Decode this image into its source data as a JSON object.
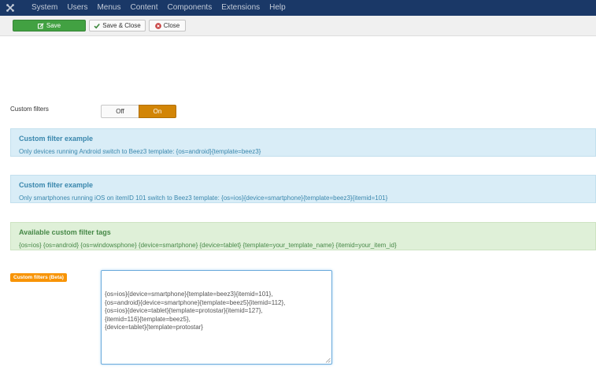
{
  "nav": {
    "logo_icon": "joomla-icon",
    "items": [
      "System",
      "Users",
      "Menus",
      "Content",
      "Components",
      "Extensions",
      "Help"
    ]
  },
  "toolbar": {
    "save_label": "Save",
    "save_close_label": "Save & Close",
    "close_label": "Close"
  },
  "custom_filters": {
    "label": "Custom filters",
    "off_label": "Off",
    "on_label": "On",
    "selected": "On"
  },
  "alerts": [
    {
      "title": "Custom filter example",
      "text": "Only devices running Android switch to Beez3 template: {os=android}{template=beez3}"
    },
    {
      "title": "Custom filter example",
      "text": "Only smartphones running iOS on itemID 101 switch to Beez3 template: {os=ios}{device=smartphone}{template=beez3}{itemid=101}"
    },
    {
      "title": "Available custom filter tags",
      "text": "{os=ios} {os=android} {os=windowsphone} {device=smartphone} {device=tablet} {template=your_template_name} {itemid=your_item_id}"
    }
  ],
  "beta_field": {
    "label": "Custom filters (Beta)",
    "value": "{os=ios}{device=smartphone}{template=beez3}{itemid=101},\n{os=android}{device=smartphone}{template=beez5}{itemid=112},\n{os=ios}{device=tablet}{template=protostar}{itemid=127},\n{itemid=116}{template=beez5},\n{device=tablet}{template=protostar}"
  },
  "colors": {
    "navbar": "#1a3867",
    "save_button": "#42a142",
    "toggle_on": "#d28506",
    "badge": "#f89406",
    "info_bg": "#d9edf7",
    "success_bg": "#dff0d8"
  }
}
